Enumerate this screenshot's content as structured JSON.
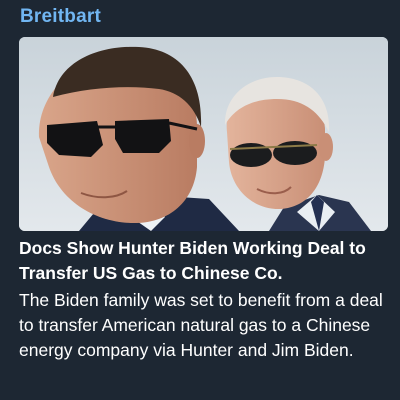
{
  "post": {
    "source_name": "Breitbart",
    "headline": "Docs Show Hunter Biden Working Deal to Transfer US Gas to Chinese Co.",
    "description": "The Biden family was set to benefit from a deal to transfer American natural gas to a Chinese energy company via Hunter and Jim Biden."
  },
  "colors": {
    "background": "#1d2733",
    "source_name": "#71b6f2",
    "text": "#ffffff"
  }
}
